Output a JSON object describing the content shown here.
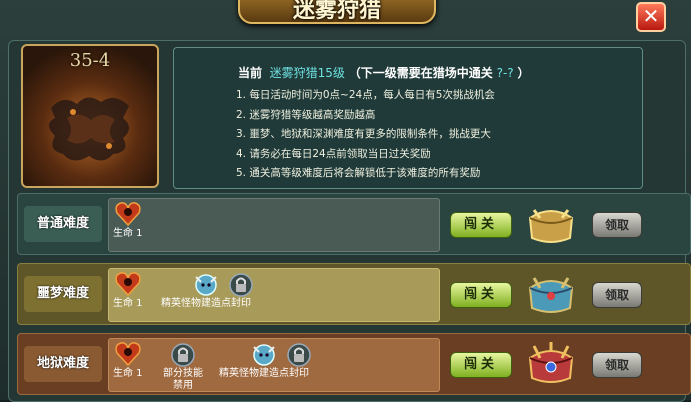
{
  "window": {
    "title": "迷雾狩猎",
    "close_icon": "close-icon"
  },
  "stage": {
    "label": "35-4"
  },
  "info": {
    "current_label": "当前",
    "current_mode": "迷雾狩猎15级",
    "requirement": "（下一级需要在猎场中通关",
    "requirement_target": "?-?",
    "requirement_end": "）",
    "rules": [
      "1. 每日活动时间为0点~24点，每人每日有5次挑战机会",
      "2. 迷雾狩猎等级越高奖励越高",
      "3. 噩梦、地狱和深渊难度有更多的限制条件，挑战更大",
      "4. 请务必在每日24点前领取当日过关奖励",
      "5. 通关高等级难度后将会解锁低于该难度的所有奖励"
    ]
  },
  "difficulties": [
    {
      "name": "普通难度",
      "items": [
        {
          "icon": "heart-demon-icon",
          "label": "生命 1"
        }
      ],
      "go_label": "闯关",
      "claim_label": "领取",
      "reward_icon": "gold-chest-icon"
    },
    {
      "name": "噩梦难度",
      "items": [
        {
          "icon": "heart-demon-icon",
          "label": "生命 1"
        },
        {
          "icon": "elite-monster-icon",
          "label": "精英怪物建造点封印"
        },
        {
          "icon": "lock-icon",
          "label": ""
        }
      ],
      "go_label": "闯关",
      "claim_label": "领取",
      "reward_icon": "blue-chest-icon"
    },
    {
      "name": "地狱难度",
      "items": [
        {
          "icon": "heart-demon-icon",
          "label": "生命 1"
        },
        {
          "icon": "lock-icon",
          "label": "部分技能禁用"
        },
        {
          "icon": "elite-monster-icon",
          "label": "精英怪物建造点封印"
        },
        {
          "icon": "lock-icon",
          "label": ""
        }
      ],
      "go_label": "闯关",
      "claim_label": "领取",
      "reward_icon": "red-chest-icon"
    }
  ],
  "colors": {
    "normal_row": "#2e4a44",
    "nightmare_row": "#6e6530",
    "hell_row": "#7a4a28",
    "accent_gold": "#c9a55e",
    "cyan_text": "#6ee0e0"
  }
}
